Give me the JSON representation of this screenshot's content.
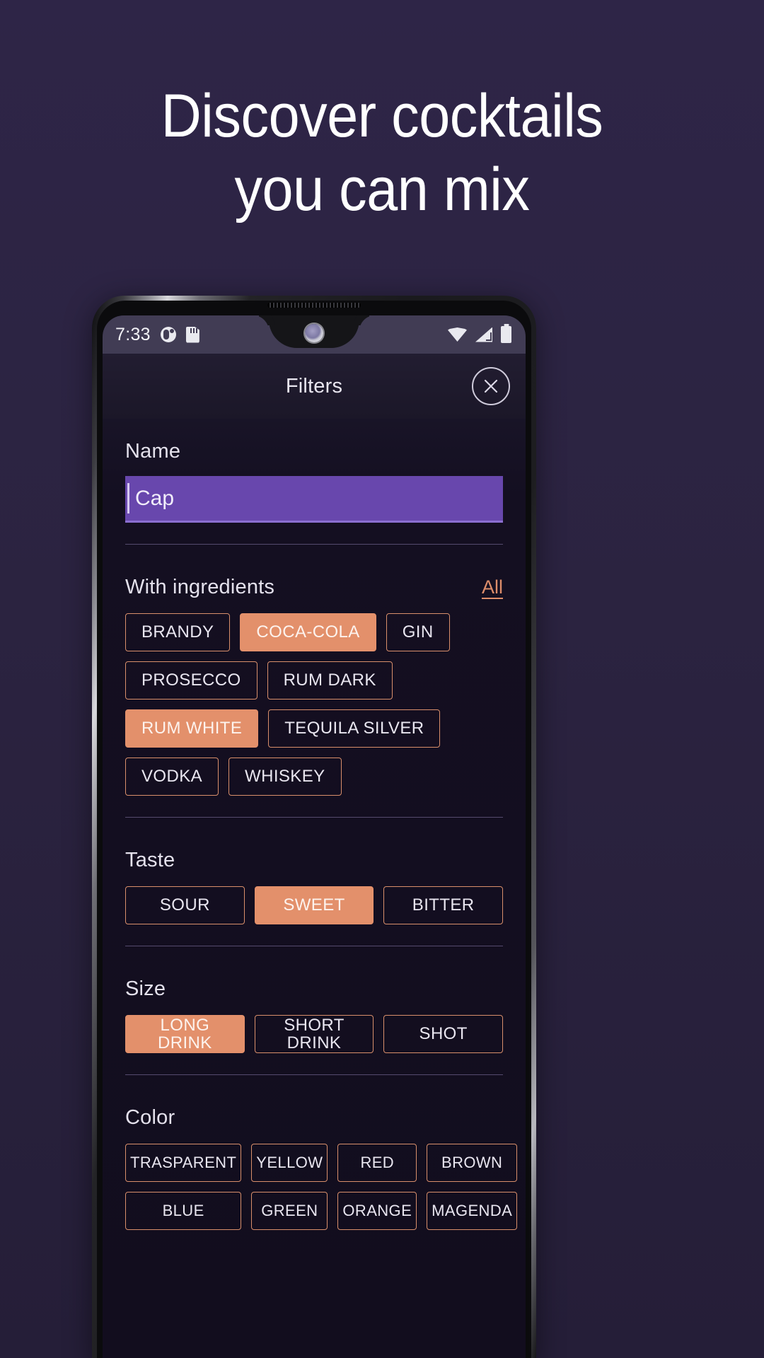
{
  "page": {
    "headline_line1": "Discover cocktails",
    "headline_line2": "you can mix",
    "background_color": "#2b2340"
  },
  "statusbar": {
    "time": "7:33",
    "left_icons": [
      "contrast-icon",
      "sd-card-icon"
    ],
    "right_icons": [
      "wifi-icon",
      "signal-icon",
      "battery-icon"
    ],
    "background_color": "#413c54"
  },
  "app": {
    "topbar": {
      "title": "Filters",
      "close_icon": "close-icon"
    },
    "name": {
      "label": "Name",
      "value": "Cap",
      "placeholder": ""
    },
    "ingredients": {
      "label": "With ingredients",
      "all_label": "All",
      "chips": [
        {
          "label": "BRANDY",
          "selected": false
        },
        {
          "label": "COCA-COLA",
          "selected": true
        },
        {
          "label": "GIN",
          "selected": false
        },
        {
          "label": "PROSECCO",
          "selected": false
        },
        {
          "label": "RUM DARK",
          "selected": false
        },
        {
          "label": "RUM WHITE",
          "selected": true
        },
        {
          "label": "TEQUILA SILVER",
          "selected": false
        },
        {
          "label": "VODKA",
          "selected": false
        },
        {
          "label": "WHISKEY",
          "selected": false
        }
      ]
    },
    "taste": {
      "label": "Taste",
      "chips": [
        {
          "label": "SOUR",
          "selected": false
        },
        {
          "label": "SWEET",
          "selected": true
        },
        {
          "label": "BITTER",
          "selected": false
        }
      ]
    },
    "size": {
      "label": "Size",
      "chips": [
        {
          "label": "LONG DRINK",
          "selected": true
        },
        {
          "label": "SHORT DRINK",
          "selected": false
        },
        {
          "label": "SHOT",
          "selected": false
        }
      ]
    },
    "color": {
      "label": "Color",
      "chips": [
        {
          "label": "TRASPARENT",
          "selected": false
        },
        {
          "label": "YELLOW",
          "selected": false
        },
        {
          "label": "RED",
          "selected": false
        },
        {
          "label": "BROWN",
          "selected": false
        },
        {
          "label": "BLUE",
          "selected": false
        },
        {
          "label": "GREEN",
          "selected": false
        },
        {
          "label": "ORANGE",
          "selected": false
        },
        {
          "label": "MAGENDA",
          "selected": false
        }
      ]
    },
    "colors": {
      "accent": "#e3906b",
      "chip_border": "#d98f6b",
      "input_fill": "#6847ad",
      "screen_bg": "#140f21"
    }
  }
}
